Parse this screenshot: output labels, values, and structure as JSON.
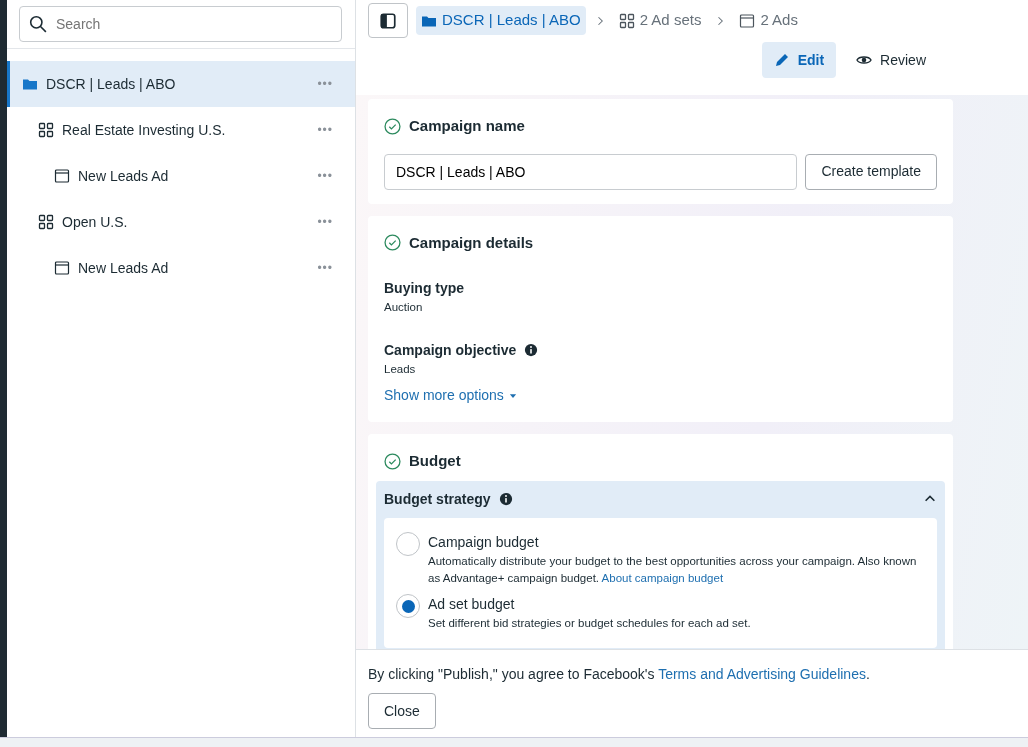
{
  "sidebar": {
    "search": {
      "placeholder": "Search"
    },
    "tree": [
      {
        "kind": "campaign",
        "label": "DSCR | Leads | ABO",
        "selected": true,
        "menu": "•••",
        "children": [
          {
            "kind": "adset",
            "label": "Real Estate Investing U.S.",
            "selected": false,
            "menu": "•••",
            "children": [
              {
                "kind": "ad",
                "label": "New Leads Ad",
                "selected": false,
                "menu": "•••"
              }
            ]
          },
          {
            "kind": "adset",
            "label": "Open U.S.",
            "selected": false,
            "menu": "•••",
            "children": [
              {
                "kind": "ad",
                "label": "New Leads Ad",
                "selected": false,
                "menu": "•••"
              }
            ]
          }
        ]
      }
    ]
  },
  "breadcrumb": [
    {
      "kind": "campaign",
      "label": "DSCR | Leads | ABO",
      "selected": true
    },
    {
      "kind": "adset",
      "label": "2 Ad sets",
      "selected": false
    },
    {
      "kind": "ad",
      "label": "2 Ads",
      "selected": false
    }
  ],
  "modes": [
    {
      "kind": "edit",
      "label": "Edit",
      "selected": true
    },
    {
      "kind": "review",
      "label": "Review",
      "selected": false
    }
  ],
  "campaign_name": {
    "title": "Campaign name",
    "value": "DSCR | Leads | ABO",
    "button": "Create template"
  },
  "campaign_details": {
    "title": "Campaign details",
    "fields": [
      {
        "label": "Buying type",
        "value": "Auction",
        "info": false
      },
      {
        "label": "Campaign objective",
        "value": "Leads",
        "info": true
      }
    ],
    "more": "Show more options"
  },
  "budget": {
    "title": "Budget",
    "strategy": {
      "label": "Budget strategy",
      "expanded": true,
      "options": [
        {
          "label": "Campaign budget",
          "description": "Automatically distribute your budget to the best opportunities across your campaign. Also known as Advantage+ campaign budget.",
          "link": "About campaign budget",
          "selected": false
        },
        {
          "label": "Ad set budget",
          "description": "Set different bid strategies or budget schedules for each ad set.",
          "selected": true
        }
      ]
    }
  },
  "footer": {
    "text_before": "By clicking \"Publish,\" you agree to Facebook's ",
    "link": "Terms and Advertising Guidelines",
    "text_after": ".",
    "button": "Close"
  }
}
